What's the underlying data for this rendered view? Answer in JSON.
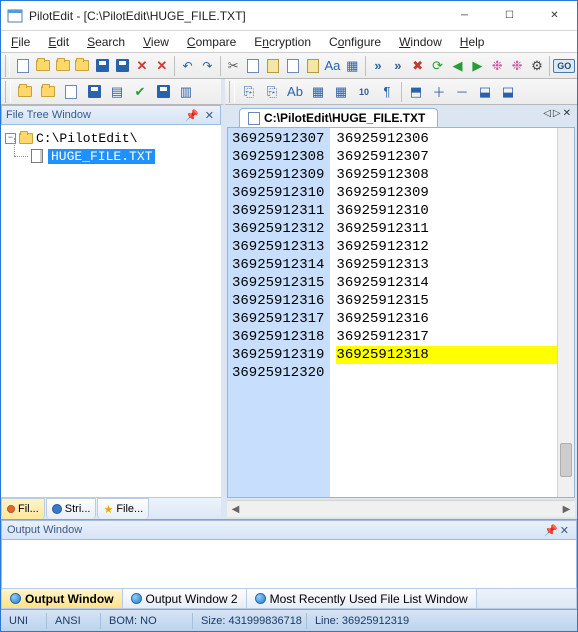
{
  "window": {
    "title": "PilotEdit - [C:\\PilotEdit\\HUGE_FILE.TXT]"
  },
  "menu": {
    "file": "File",
    "edit": "Edit",
    "search": "Search",
    "view": "View",
    "compare": "Compare",
    "encryption": "Encryption",
    "configure": "Configure",
    "window": "Window",
    "help": "Help"
  },
  "toolbar": {
    "go_label": "GO"
  },
  "sidebar": {
    "title": "File Tree Window",
    "root": "C:\\PilotEdit\\",
    "file": "HUGE_FILE.TXT",
    "tabs": {
      "file": "Fil...",
      "string": "Stri...",
      "fav": "File..."
    }
  },
  "editor": {
    "tab_title": "C:\\PilotEdit\\HUGE_FILE.TXT",
    "gutter": [
      "36925912307",
      "36925912308",
      "36925912309",
      "36925912310",
      "36925912311",
      "36925912312",
      "36925912313",
      "36925912314",
      "36925912315",
      "36925912316",
      "36925912317",
      "36925912318",
      "36925912319",
      "36925912320"
    ],
    "lines": [
      "36925912306",
      "36925912307",
      "36925912308",
      "36925912309",
      "36925912310",
      "36925912311",
      "36925912312",
      "36925912313",
      "36925912314",
      "36925912315",
      "36925912316",
      "36925912317",
      "36925912318",
      ""
    ],
    "highlight_index": 12
  },
  "output": {
    "title": "Output Window",
    "tabs": {
      "w1": "Output Window",
      "w2": "Output Window 2",
      "mru": "Most Recently Used File List Window"
    }
  },
  "status": {
    "enc1": "UNI",
    "enc2": "ANSI",
    "bom": "BOM: NO",
    "size": "Size: 431999836718",
    "line": "Line: 36925912319"
  }
}
